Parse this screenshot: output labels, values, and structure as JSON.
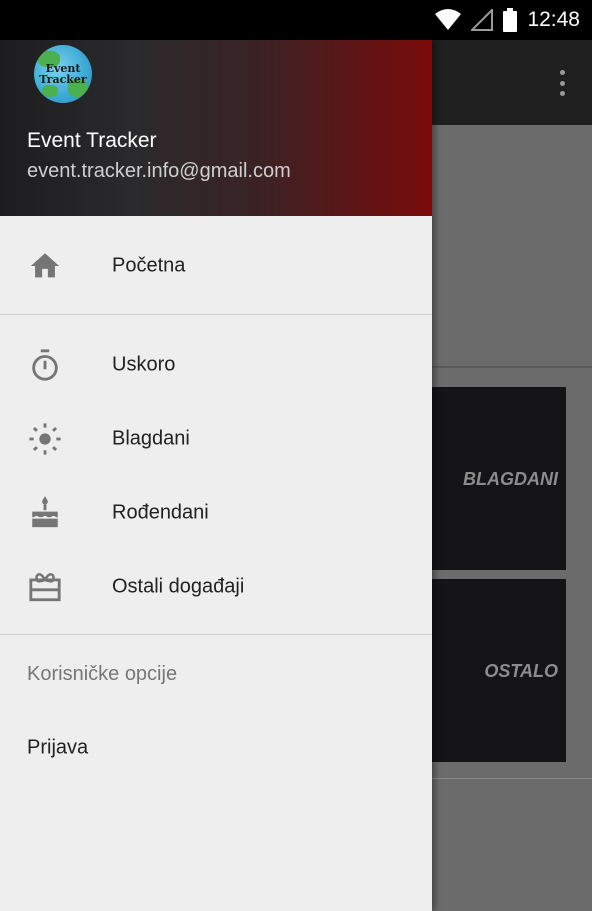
{
  "status_bar": {
    "time": "12:48",
    "icons": [
      "wifi-icon",
      "signal-icon",
      "battery-icon"
    ]
  },
  "background_app": {
    "cards": [
      {
        "label": "BLAGDANI"
      },
      {
        "label": "OSTALO"
      }
    ]
  },
  "drawer": {
    "header": {
      "logo_text": "Event Tracker",
      "name": "Event Tracker",
      "email": "event.tracker.info@gmail.com"
    },
    "items": [
      {
        "label": "Početna",
        "icon": "home-icon"
      },
      {
        "label": "Uskoro",
        "icon": "timer-icon"
      },
      {
        "label": "Blagdani",
        "icon": "sunny-icon"
      },
      {
        "label": "Rođendani",
        "icon": "cake-icon"
      },
      {
        "label": "Ostali događaji",
        "icon": "gift-card-icon"
      }
    ],
    "section_title": "Korisničke opcije",
    "options": [
      {
        "label": "Prijava"
      }
    ]
  },
  "colors": {
    "header_start": "#1d1d1f",
    "header_end": "#7a0b0b",
    "drawer_bg": "#eeeeee",
    "icon_gray": "#757575"
  }
}
